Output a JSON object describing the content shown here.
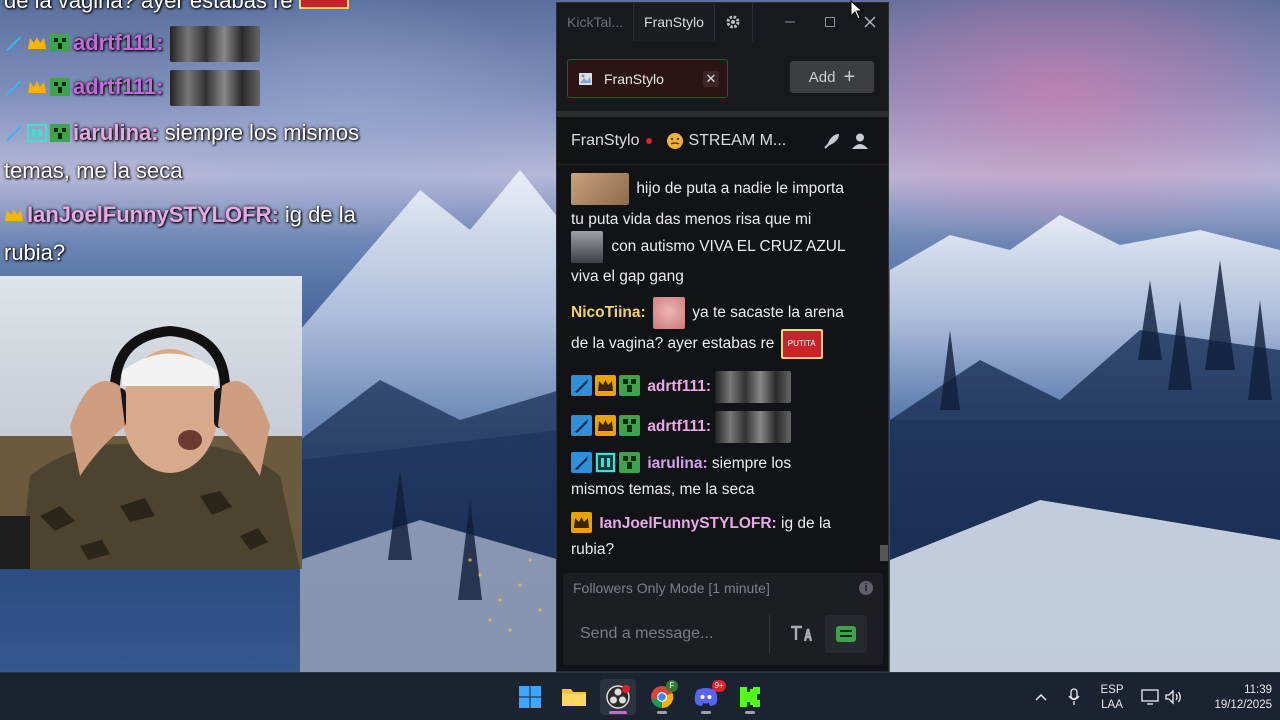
{
  "overlay": {
    "line0": "de la vagina? ayer estabas re",
    "line1_user": "adrtf111:",
    "line2_user": "adrtf111:",
    "line3_user": "iarulina:",
    "line3_text": "siempre los mismos",
    "line4_text": "temas, me la seca",
    "line5_user": "IanJoelFunnySTYLOFR:",
    "line5_text": "ig de la",
    "line6_text": "rubia?"
  },
  "window": {
    "tab_inactive": "KickTal...",
    "tab_active": "FranStylo",
    "minimize": "—",
    "maximize": "☐",
    "close": "✕"
  },
  "channel_tabs": {
    "active_label": "FranStylo",
    "close_label": "✕",
    "add_label": "Add",
    "add_icon": "+"
  },
  "channel_header": {
    "name": "FranStylo",
    "stream_title": "STREAM M..."
  },
  "messages": [
    {
      "text": "hijo de puta a nadie le importa"
    },
    {
      "text": "tu puta vida das menos risa que mi"
    },
    {
      "text": "con autismo VIVA EL CRUZ AZUL"
    },
    {
      "text": "viva el gap gang"
    },
    {
      "user": "NicoTiina:",
      "text": "ya te sacaste la arena"
    },
    {
      "text": "de la vagina? ayer estabas re"
    },
    {
      "user": "adrtf111:"
    },
    {
      "user": "adrtf111:"
    },
    {
      "user": "iarulina:",
      "text": "siempre los"
    },
    {
      "text": "mismos temas, me la seca"
    },
    {
      "user": "IanJoelFunnySTYLOFR:",
      "text": "ig de la"
    },
    {
      "text": "rubia?"
    }
  ],
  "followers_mode": "Followers Only Mode [1 minute]",
  "info_icon": "i",
  "input": {
    "placeholder": "Send a message..."
  },
  "emote_label": "PUTITA",
  "taskbar": {
    "lang_top": "ESP",
    "lang_bottom": "LAA",
    "time": "11:39",
    "date": "19/12/2025",
    "chrome_badge": "F",
    "discord_badge": "9+"
  },
  "colors": {
    "kick_green": "#53fc18",
    "accent_red": "#a21d24",
    "user_nicotiina": "#f5d36b",
    "user_adrtf": "#e9a9e6",
    "user_iarulina": "#d8a0f0",
    "user_ian": "#e9a9e6"
  },
  "icons": [
    "gear-icon",
    "rocket-icon",
    "user-icon",
    "translate-icon",
    "emote-icon",
    "windows-start-icon",
    "file-explorer-icon",
    "obs-icon",
    "chrome-icon",
    "discord-icon",
    "kick-icon"
  ]
}
